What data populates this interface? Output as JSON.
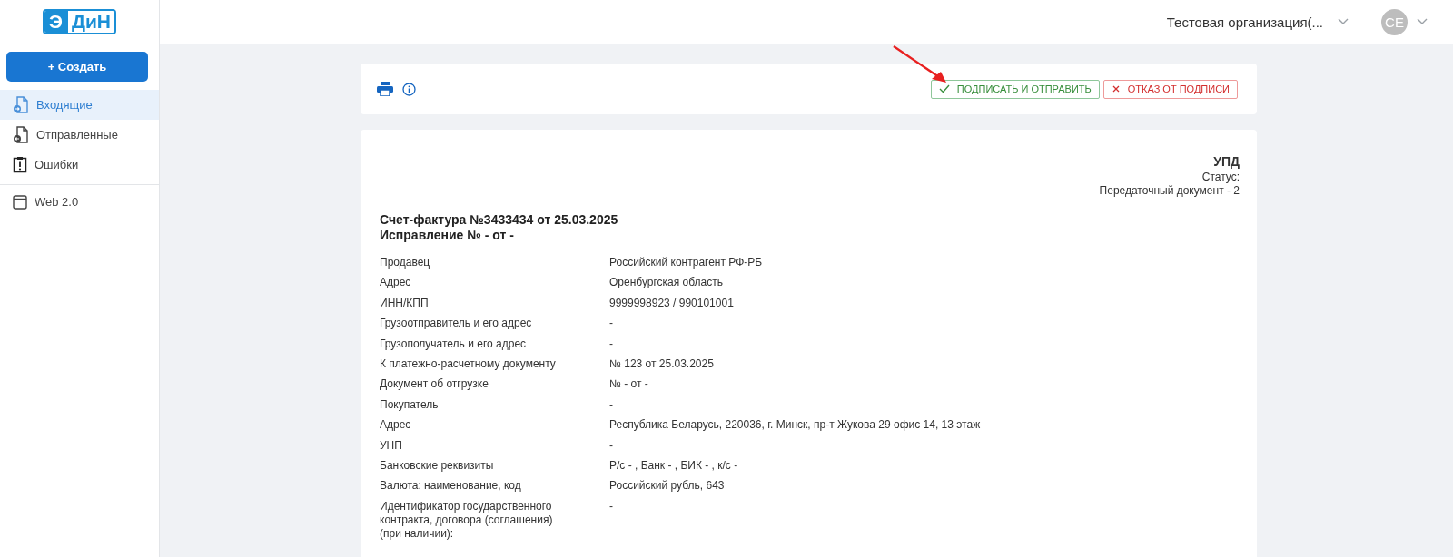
{
  "header": {
    "logo": {
      "left": "Э",
      "right": "ДиН"
    },
    "organization": "Тестовая организация(...",
    "avatar": "CE"
  },
  "sidebar": {
    "create_button": "+ Создать",
    "items": [
      {
        "label": "Входящие",
        "selected": true
      },
      {
        "label": "Отправленные",
        "selected": false
      },
      {
        "label": "Ошибки",
        "selected": false
      }
    ],
    "extra_items": [
      {
        "label": "Web 2.0",
        "selected": false
      }
    ]
  },
  "toolbar": {
    "sign_button": "ПОДПИСАТЬ И ОТПРАВИТЬ",
    "reject_button": "ОТКАЗ ОТ ПОДПИСИ"
  },
  "document": {
    "type": "УПД",
    "status": "Статус:",
    "function": "Передаточный документ - 2",
    "title": "Счет-фактура №3433434 от 25.03.2025",
    "correction": "Исправление № - от -",
    "rows": [
      {
        "label": "Продавец",
        "value": "Российский контрагент РФ-РБ"
      },
      {
        "label": "Адрес",
        "value": "Оренбургская область"
      },
      {
        "label": "ИНН/КПП",
        "value": "9999998923 / 990101001"
      },
      {
        "label": "Грузоотправитель и его адрес",
        "value": "-"
      },
      {
        "label": "Грузополучатель и его адрес",
        "value": "-"
      },
      {
        "label": "К платежно-расчетному документу",
        "value": "№ 123 от 25.03.2025"
      },
      {
        "label": "Документ об отгрузке",
        "value": "№ - от -"
      },
      {
        "label": "Покупатель",
        "value": "-"
      },
      {
        "label": "Адрес",
        "value": "Республика Беларусь, 220036, г. Минск, пр-т Жукова 29 офис 14, 13 этаж"
      },
      {
        "label": "УНП",
        "value": "-"
      },
      {
        "label": "Банковские реквизиты",
        "value": "Р/с - , Банк - , БИК - , к/с -"
      },
      {
        "label": "Валюта: наименование, код",
        "value": "Российский рубль, 643"
      },
      {
        "label": "Идентификатор государственного контракта, договора (соглашения) (при наличии):",
        "value": "-"
      }
    ]
  }
}
